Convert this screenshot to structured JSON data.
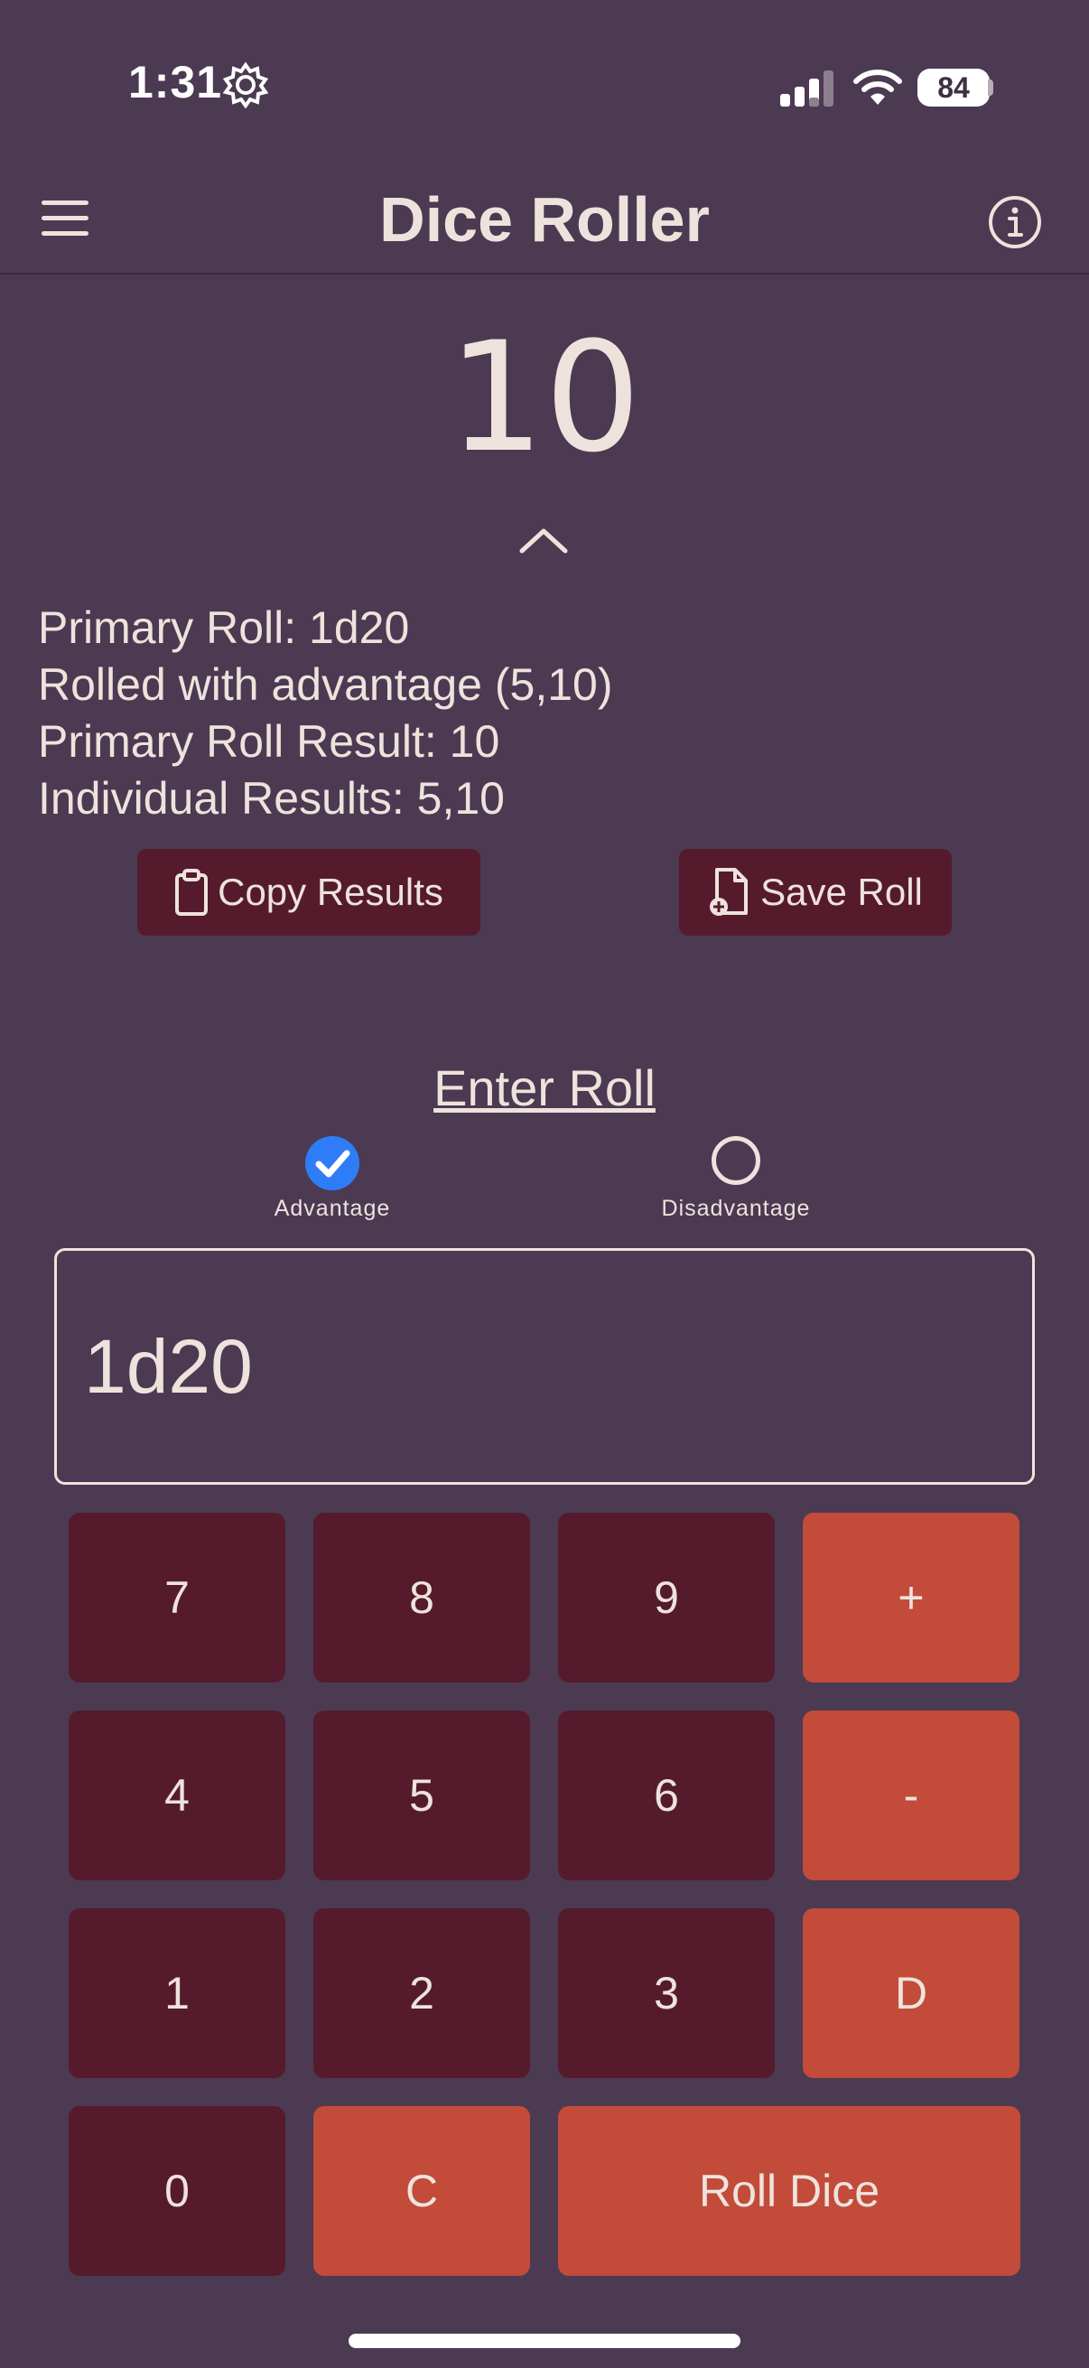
{
  "status_bar": {
    "time": "1:31",
    "battery": "84"
  },
  "header": {
    "title": "Dice Roller",
    "menu_icon": "hamburger-menu-icon",
    "info_icon": "info-circle-icon"
  },
  "result": {
    "value": "10",
    "collapse_icon": "chevron-up-icon",
    "details": [
      "Primary Roll: 1d20",
      "Rolled with advantage (5,10)",
      "Primary Roll Result: 10",
      "Individual Results: 5,10"
    ],
    "copy_label": "Copy Results",
    "save_label": "Save Roll"
  },
  "entry": {
    "title": "Enter Roll",
    "advantage_label": "Advantage",
    "advantage_checked": true,
    "disadvantage_label": "Disadvantage",
    "disadvantage_checked": false,
    "input_value": "1d20"
  },
  "keypad": {
    "rows": [
      [
        "7",
        "8",
        "9",
        "+"
      ],
      [
        "4",
        "5",
        "6",
        "-"
      ],
      [
        "1",
        "2",
        "3",
        "D"
      ],
      [
        "0",
        "C",
        "Roll Dice"
      ]
    ]
  },
  "colors": {
    "background": "#4b3a52",
    "number_key": "#551b2d",
    "operator_key": "#c24b3a",
    "checkbox": "#2f7df6",
    "text": "#eee3dc"
  }
}
